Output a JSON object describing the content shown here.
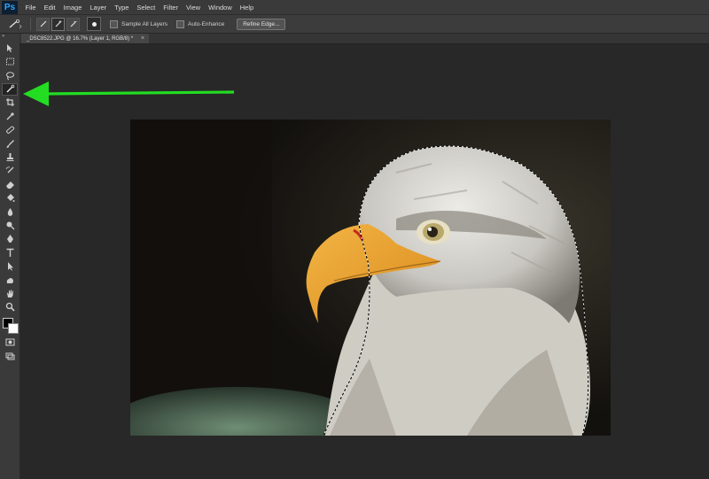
{
  "app": {
    "logo": "Ps"
  },
  "menu": [
    "File",
    "Edit",
    "Image",
    "Layer",
    "Type",
    "Select",
    "Filter",
    "View",
    "Window",
    "Help"
  ],
  "options": {
    "sample_all_layers": "Sample All Layers",
    "auto_enhance": "Auto-Enhance",
    "refine_edge": "Refine Edge..."
  },
  "document": {
    "tab_title": "_DSC8522.JPG @ 16.7% (Layer 1, RGB/8) *",
    "close": "×"
  },
  "toolbar": {
    "collapse": "»",
    "tools": [
      "move-tool",
      "marquee-tool",
      "lasso-tool",
      "quick-selection-tool",
      "crop-tool",
      "eyedropper-tool",
      "spot-healing-tool",
      "brush-tool",
      "clone-stamp-tool",
      "history-brush-tool",
      "eraser-tool",
      "paint-bucket-tool",
      "blur-tool",
      "dodge-tool",
      "pen-tool",
      "type-tool",
      "path-selection-tool",
      "shape-tool",
      "hand-tool",
      "zoom-tool"
    ],
    "active_tool": "quick-selection-tool",
    "foreground_color": "#000000",
    "background_color": "#ffffff"
  },
  "colors": {
    "annotation_arrow": "#22dd22",
    "app_bg": "#282828"
  }
}
